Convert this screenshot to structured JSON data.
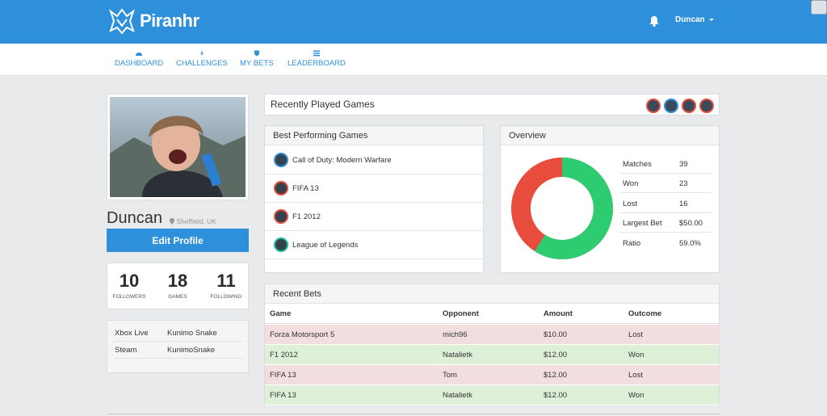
{
  "app": {
    "name": "Piranhr"
  },
  "header": {
    "username": "Duncan"
  },
  "nav": [
    {
      "label": "DASHBOARD",
      "icon": "dashboard-icon"
    },
    {
      "label": "CHALLENGES",
      "icon": "bolt-icon"
    },
    {
      "label": "MY BETS",
      "icon": "shield-icon"
    },
    {
      "label": "LEADERBOARD",
      "icon": "list-icon"
    }
  ],
  "profile": {
    "name": "Duncan",
    "location": "Sheffield, UK",
    "edit_label": "Edit Profile",
    "stats": [
      {
        "value": "10",
        "label": "FOLLOWERS"
      },
      {
        "value": "18",
        "label": "GAMES"
      },
      {
        "value": "11",
        "label": "FOLLOWING"
      }
    ],
    "accounts": [
      {
        "service": "Xbox Live",
        "handle": "Kunimo Snake"
      },
      {
        "service": "Steam",
        "handle": "KunimoSnake"
      }
    ]
  },
  "recently_played": {
    "title": "Recently Played Games",
    "count": 4
  },
  "best_games": {
    "title": "Best Performing Games",
    "items": [
      {
        "name": "Call of Duty: Modern Warfare",
        "ring": "#2e8fda"
      },
      {
        "name": "FIFA 13",
        "ring": "#e74c3c"
      },
      {
        "name": "F1 2012",
        "ring": "#e74c3c"
      },
      {
        "name": "League of Legends",
        "ring": "#1abc9c"
      }
    ]
  },
  "overview": {
    "title": "Overview",
    "won_share": 0.59,
    "colors": {
      "won": "#2ecc71",
      "lost": "#e74c3c"
    },
    "rows": [
      {
        "key": "Matches",
        "value": "39"
      },
      {
        "key": "Won",
        "value": "23"
      },
      {
        "key": "Lost",
        "value": "16"
      },
      {
        "key": "Largest Bet",
        "value": "$50.00"
      },
      {
        "key": "Ratio",
        "value": "59.0%"
      }
    ]
  },
  "recent_bets": {
    "title": "Recent Bets",
    "columns": [
      "Game",
      "Opponent",
      "Amount",
      "Outcome"
    ],
    "rows": [
      {
        "game": "Forza Motorsport 5",
        "opponent": "mich96",
        "amount": "$10.00",
        "outcome": "Lost"
      },
      {
        "game": "F1 2012",
        "opponent": "Natalietk",
        "amount": "$12.00",
        "outcome": "Won"
      },
      {
        "game": "FIFA 13",
        "opponent": "Tom",
        "amount": "$12.00",
        "outcome": "Lost"
      },
      {
        "game": "FIFA 13",
        "opponent": "Natalietk",
        "amount": "$12.00",
        "outcome": "Won"
      }
    ]
  },
  "colors": {
    "brand": "#2e8fda",
    "lost_row": "#f2dede",
    "won_row": "#dff0d8"
  }
}
